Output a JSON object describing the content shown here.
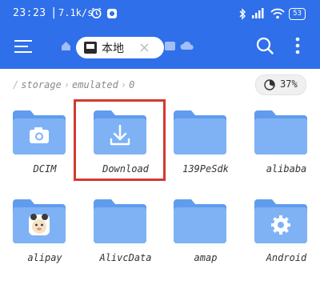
{
  "status_bar": {
    "time": "23:23",
    "separator": "|",
    "net_speed": "7.1k/s",
    "battery": "53"
  },
  "toolbar": {
    "menu_icon": "hamburger-menu-icon",
    "home_icon": "home-icon",
    "tab_label": "本地",
    "search_icon": "search-icon",
    "more_icon": "more-vertical-icon"
  },
  "breadcrumb": {
    "items": [
      "storage",
      "emulated",
      "0"
    ]
  },
  "storage": {
    "percent": "37%"
  },
  "folders": [
    {
      "name": "DCIM",
      "icon": "camera-icon"
    },
    {
      "name": "Download",
      "icon": "download-icon"
    },
    {
      "name": "139PeSdk",
      "icon": ""
    },
    {
      "name": "alibaba",
      "icon": ""
    },
    {
      "name": "alipay",
      "icon": "alipay-mascot-icon"
    },
    {
      "name": "AlivcData",
      "icon": ""
    },
    {
      "name": "amap",
      "icon": ""
    },
    {
      "name": "Android",
      "icon": "gear-icon"
    }
  ],
  "colors": {
    "header": "#2f6fea",
    "folder_back": "#5f9cee",
    "folder_front": "#7fb2f5",
    "highlight_border": "#d23a2f"
  }
}
